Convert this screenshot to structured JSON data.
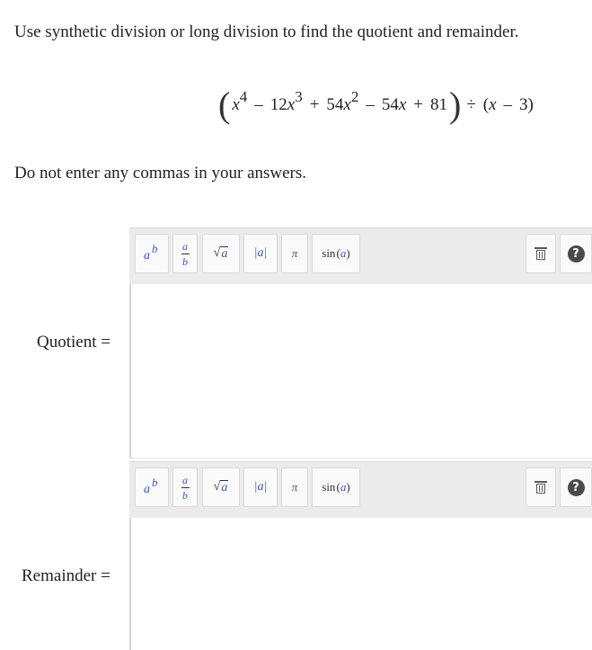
{
  "instructions": "Use synthetic division or long division to find the quotient and remainder.",
  "equation": {
    "lparen": "(",
    "rparen": ")",
    "t1_var": "x",
    "t1_exp": "4",
    "op1": "–",
    "t2_coef": "12",
    "t2_var": "x",
    "t2_exp": "3",
    "op2": "+",
    "t3_coef": "54",
    "t3_var": "x",
    "t3_exp": "2",
    "op3": "–",
    "t4_coef": "54",
    "t4_var": "x",
    "op4": "+",
    "t5": "81",
    "div": "÷",
    "d_open": "(",
    "d_var": "x",
    "d_op": "–",
    "d_const": "3",
    "d_close": ")"
  },
  "note": "Do not enter any commas in your answers.",
  "toolbar": {
    "pow_base": "a",
    "pow_exp": "b",
    "frac_num": "a",
    "frac_den": "b",
    "sqrt_symbol": "√",
    "sqrt_arg": "a",
    "abs_text": "|a|",
    "pi": "π",
    "sin_text": "sin",
    "sin_arg_open": "(",
    "sin_arg": "a",
    "sin_arg_close": ")",
    "help": "?",
    "icons": [
      "superscript-icon",
      "fraction-icon",
      "sqrt-icon",
      "abs-icon",
      "pi-icon",
      "sin-icon",
      "trash-icon",
      "help-icon"
    ]
  },
  "fields": {
    "quotient_label": "Quotient =",
    "quotient_value": "",
    "remainder_label": "Remainder =",
    "remainder_value": ""
  },
  "colors": {
    "toolbar_bg": "#ebebeb",
    "accent_blue": "#3b56c8",
    "text": "#222222"
  }
}
